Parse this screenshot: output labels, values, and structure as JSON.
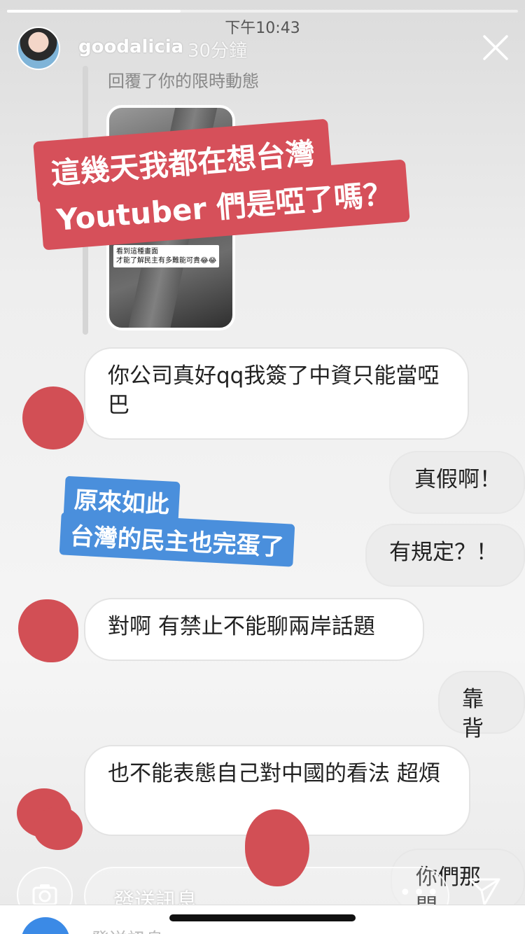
{
  "status_bar": {
    "time": "下午10:43"
  },
  "story_progress": 0.34,
  "header": {
    "username": "goodalicia",
    "time_ago": "30分鐘",
    "close_icon": "close-icon"
  },
  "reply_context": {
    "label": "回覆了你的限時動態",
    "thumbnail_caption": "看到這種畫面\n才能了解民主有多難能可貴😂😂"
  },
  "stickers": {
    "red_line1": "這幾天我都在想台灣",
    "red_line2": "Youtuber 們是啞了嗎？",
    "blue_line1": "原來如此",
    "blue_line2": "台灣的民主也完蛋了",
    "red_color": "#d6505a",
    "blue_color": "#4a8fdc"
  },
  "messages": [
    {
      "sender": "other",
      "text": "你公司真好qq我簽了中資只能當啞巴"
    },
    {
      "sender": "self",
      "text": "真假啊！"
    },
    {
      "sender": "self",
      "text": "有規定？！"
    },
    {
      "sender": "other",
      "text": "對啊 有禁止不能聊兩岸話題"
    },
    {
      "sender": "self",
      "text": "靠背"
    },
    {
      "sender": "other",
      "text": "也不能表態自己對中國的看法 超煩"
    },
    {
      "sender": "self",
      "text": "你們那間"
    }
  ],
  "reply_bar": {
    "placeholder": "發送訊息",
    "more": "•••",
    "camera_icon": "camera-icon",
    "send_icon": "send-icon"
  },
  "ghost_bar": {
    "placeholder": "發送訊息"
  }
}
